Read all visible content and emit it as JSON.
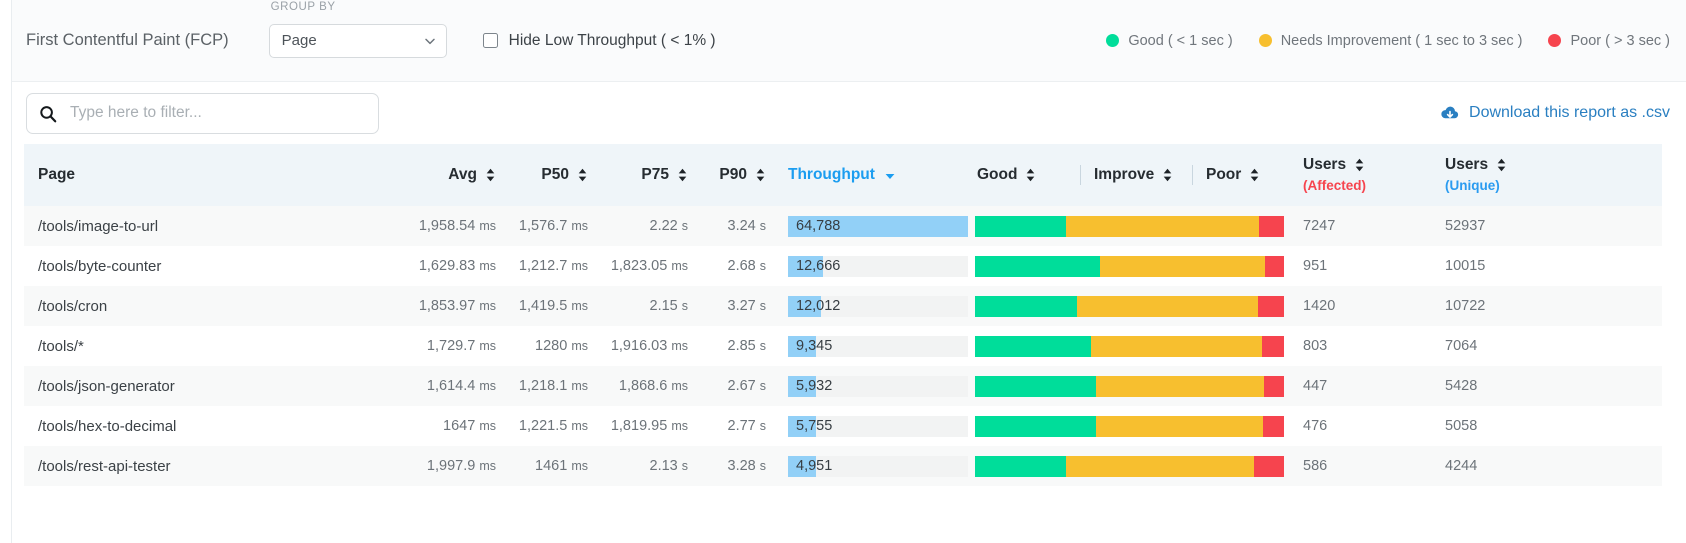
{
  "toolbar": {
    "metric_title": "First Contentful Paint (FCP)",
    "group_by_label": "GROUP BY",
    "group_by_value": "Page",
    "group_by_options": [
      "Page"
    ],
    "hide_low_throughput_label": "Hide Low Throughput ( < 1% )",
    "hide_low_throughput_checked": false,
    "chevron_icon": "chevron-down-icon"
  },
  "legend": [
    {
      "label": "Good ( < 1 sec )",
      "color": "#00dd9a",
      "icon": "legend-dot-good"
    },
    {
      "label": "Needs Improvement ( 1 sec to 3 sec )",
      "color": "#f7bf2f",
      "icon": "legend-dot-needs-improvement"
    },
    {
      "label": "Poor ( > 3 sec )",
      "color": "#f6444e",
      "icon": "legend-dot-poor"
    }
  ],
  "filter": {
    "search_placeholder": "Type here to filter...",
    "search_value": "",
    "search_icon": "search-icon",
    "download_label": "Download this report as .csv",
    "download_icon": "cloud-download-icon"
  },
  "table": {
    "columns": {
      "page": "Page",
      "avg": "Avg",
      "p50": "P50",
      "p75": "P75",
      "p90": "P90",
      "throughput": "Throughput",
      "good": "Good",
      "improve": "Improve",
      "poor": "Poor",
      "users_affected_main": "Users",
      "users_affected_sub": "(Affected)",
      "users_unique_main": "Users",
      "users_unique_sub": "(Unique)"
    },
    "sorted_column": "throughput",
    "sort_direction": "desc",
    "rows": [
      {
        "page": "/tools/image-to-url",
        "avg": "1,958.54 ms",
        "p50": "1,576.7 ms",
        "p75": "2.22 s",
        "p90": "3.24 s",
        "throughput": "64,788",
        "throughput_value": 64788,
        "good_pct": 29.5,
        "improve_pct": 62.5,
        "poor_pct": 8.0,
        "users_affected": "7247",
        "users_unique": "52937"
      },
      {
        "page": "/tools/byte-counter",
        "avg": "1,629.83 ms",
        "p50": "1,212.7 ms",
        "p75": "1,823.05 ms",
        "p90": "2.68 s",
        "throughput": "12,666",
        "throughput_value": 12666,
        "good_pct": 40.5,
        "improve_pct": 53.5,
        "poor_pct": 6.0,
        "users_affected": "951",
        "users_unique": "10015"
      },
      {
        "page": "/tools/cron",
        "avg": "1,853.97 ms",
        "p50": "1,419.5 ms",
        "p75": "2.15 s",
        "p90": "3.27 s",
        "throughput": "12,012",
        "throughput_value": 12012,
        "good_pct": 33.0,
        "improve_pct": 58.5,
        "poor_pct": 8.5,
        "users_affected": "1420",
        "users_unique": "10722"
      },
      {
        "page": "/tools/*",
        "avg": "1,729.7 ms",
        "p50": "1280 ms",
        "p75": "1,916.03 ms",
        "p90": "2.85 s",
        "throughput": "9,345",
        "throughput_value": 9345,
        "good_pct": 37.5,
        "improve_pct": 55.5,
        "poor_pct": 7.0,
        "users_affected": "803",
        "users_unique": "7064"
      },
      {
        "page": "/tools/json-generator",
        "avg": "1,614.4 ms",
        "p50": "1,218.1 ms",
        "p75": "1,868.6 ms",
        "p90": "2.67 s",
        "throughput": "5,932",
        "throughput_value": 5932,
        "good_pct": 39.0,
        "improve_pct": 54.5,
        "poor_pct": 6.5,
        "users_affected": "447",
        "users_unique": "5428"
      },
      {
        "page": "/tools/hex-to-decimal",
        "avg": "1647 ms",
        "p50": "1,221.5 ms",
        "p75": "1,819.95 ms",
        "p90": "2.77 s",
        "throughput": "5,755",
        "throughput_value": 5755,
        "good_pct": 39.0,
        "improve_pct": 54.0,
        "poor_pct": 7.0,
        "users_affected": "476",
        "users_unique": "5058"
      },
      {
        "page": "/tools/rest-api-tester",
        "avg": "1,997.9 ms",
        "p50": "1461 ms",
        "p75": "2.13 s",
        "p90": "3.28 s",
        "throughput": "4,951",
        "throughput_value": 4951,
        "good_pct": 29.5,
        "improve_pct": 61.0,
        "poor_pct": 9.5,
        "users_affected": "586",
        "users_unique": "4244"
      }
    ]
  },
  "colors": {
    "good": "#00dd9a",
    "improve": "#f7bf2f",
    "poor": "#f6444e",
    "throughput_bar": "#92d0f7",
    "throughput_track": "#f2f3f3",
    "accent_blue": "#1b9df0",
    "link_blue": "#2a7fc1",
    "header_bg": "#eff5f9"
  }
}
